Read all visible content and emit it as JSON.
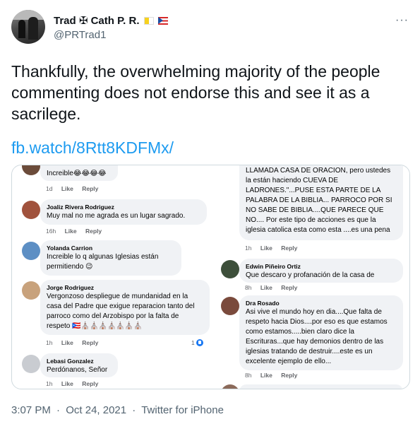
{
  "tweet": {
    "display_name": "Trad ✠ Cath P. R.",
    "handle": "@PRTrad1",
    "more_label": "···",
    "text": "Thankfully, the overwhelming majority of the people commenting does not endorse this and see it as a sacrilege.",
    "link": "fb.watch/8Rtt8KDFMx/",
    "time": "3:07 PM",
    "separator": "·",
    "date": "Oct 24, 2021",
    "source": "Twitter for iPhone"
  },
  "media": {
    "left_comments": [
      {
        "author": "",
        "text": "Increible😂😂😂😂",
        "time": "1d",
        "like": "Like",
        "reply": "Reply"
      },
      {
        "author": "Joaliz Rivera Rodriguez",
        "text": "Muy mal no me agrada es un lugar sagrado.",
        "time": "16h",
        "like": "Like",
        "reply": "Reply"
      },
      {
        "author": "Yolanda Carrion",
        "text": "Increible lo q algunas Iglesias están permitiendo 😉",
        "time": "",
        "like": "",
        "reply": ""
      },
      {
        "author": "Jorge Rodriguez",
        "text": "Vergonzoso despliegue de mundanidad en la casa del Padre que exigue reparacion tanto del parroco como del Arzobispo por la falta de respeto 🇵🇷⛪⛪⛪⛪⛪⛪⛪",
        "time": "1h",
        "like": "Like",
        "reply": "Reply",
        "reactions": "1"
      },
      {
        "author": "Lebasi Gonzalez",
        "text": "Perdónanos, Señor",
        "time": "1h",
        "like": "Like",
        "reply": "Reply"
      }
    ],
    "right_comments": [
      {
        "author": "",
        "text": "LLAMADA CASA DE ORACION, pero ustedes la están haciendo CUEVA DE LADRONES.\"...PUSE ESTA PARTE DE LA PALABRA DE LA BIBLIA... PARROCO POR SI NO SABE DE BIBLIA....QUE PARECE QUE NO.... Por este tipo de acciones es que la iglesia catolica esta como esta ....es una pena",
        "time": "1h",
        "like": "Like",
        "reply": "Reply"
      },
      {
        "author": "Edwin Piñeiro Ortiz",
        "text": "Que descaro y profanación de la casa de",
        "time": "8h",
        "like": "Like",
        "reply": "Reply"
      },
      {
        "author": "Dra Rosado",
        "text": "Asi vive el mundo hoy en dia....Que falta de respeto hacia Dios....por eso es que estamos como estamos.....bien claro dice la Escrituras...que hay demonios dentro de las iglesias tratando de destruir....este es un excelente ejemplo de ello...",
        "time": "8h",
        "like": "Like",
        "reply": "Reply"
      }
    ]
  },
  "colors": {
    "link": "#1d9bf0",
    "secondary_text": "#536471",
    "fb_bubble": "#f0f2f5",
    "fb_like_blue": "#1877f2"
  }
}
